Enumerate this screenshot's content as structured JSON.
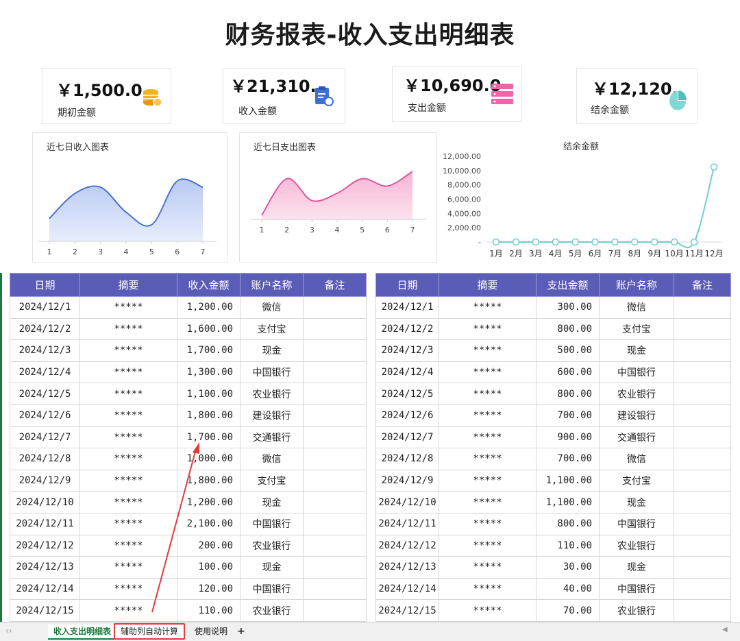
{
  "title": "财务报表-收入支出明细表",
  "cards": [
    {
      "amount": "￥1,500.0",
      "label": "期初金额",
      "icon": "coins-icon"
    },
    {
      "amount": "￥21,310.",
      "label": "收入金额",
      "icon": "clipboard-icon"
    },
    {
      "amount": "￥10,690.0",
      "label": "支出金额",
      "icon": "server-stack-icon"
    },
    {
      "amount": "￥12,120.",
      "label": "结余金额",
      "icon": "pie-icon"
    }
  ],
  "colors": {
    "header": "#5b5cb8",
    "income_line": "#4a72d0",
    "expense_line": "#e0559a",
    "balance_line": "#6dcfcb",
    "annotation": "#e23a3a"
  },
  "income_chart": {
    "title": "近七日收入图表",
    "chart_data": {
      "type": "area",
      "categories": [
        "1",
        "2",
        "3",
        "4",
        "5",
        "6",
        "7"
      ],
      "values": [
        1200,
        1600,
        1700,
        1300,
        1100,
        1800,
        1700
      ]
    }
  },
  "expense_chart": {
    "title": "近七日支出图表",
    "chart_data": {
      "type": "area",
      "categories": [
        "1",
        "2",
        "3",
        "4",
        "5",
        "6",
        "7"
      ],
      "values": [
        300,
        800,
        500,
        600,
        800,
        700,
        900
      ]
    }
  },
  "balance_chart": {
    "title": "结余金额",
    "chart_data": {
      "type": "line",
      "categories": [
        "1月",
        "2月",
        "3月",
        "4月",
        "5月",
        "6月",
        "7月",
        "8月",
        "9月",
        "10月",
        "11月",
        "12月"
      ],
      "values": [
        0,
        0,
        0,
        0,
        0,
        0,
        0,
        0,
        0,
        0,
        0,
        10500
      ],
      "yticks": [
        "12,000.00",
        "10,000.00",
        "8,000.00",
        "6,000.00",
        "4,000.00",
        "2,000.00",
        "-"
      ],
      "ylim": [
        0,
        12000
      ]
    }
  },
  "income_table": {
    "headers": [
      "日期",
      "摘要",
      "收入金额",
      "账户名称",
      "备注"
    ],
    "rows": [
      [
        "2024/12/1",
        "*****",
        "1,200.00",
        "微信",
        ""
      ],
      [
        "2024/12/2",
        "*****",
        "1,600.00",
        "支付宝",
        ""
      ],
      [
        "2024/12/3",
        "*****",
        "1,700.00",
        "现金",
        ""
      ],
      [
        "2024/12/4",
        "*****",
        "1,300.00",
        "中国银行",
        ""
      ],
      [
        "2024/12/5",
        "*****",
        "1,100.00",
        "农业银行",
        ""
      ],
      [
        "2024/12/6",
        "*****",
        "1,800.00",
        "建设银行",
        ""
      ],
      [
        "2024/12/7",
        "*****",
        "1,700.00",
        "交通银行",
        ""
      ],
      [
        "2024/12/8",
        "*****",
        "1,000.00",
        "微信",
        ""
      ],
      [
        "2024/12/9",
        "*****",
        "1,800.00",
        "支付宝",
        ""
      ],
      [
        "2024/12/10",
        "*****",
        "1,200.00",
        "现金",
        ""
      ],
      [
        "2024/12/11",
        "*****",
        "2,100.00",
        "中国银行",
        ""
      ],
      [
        "2024/12/12",
        "*****",
        "200.00",
        "农业银行",
        ""
      ],
      [
        "2024/12/13",
        "*****",
        "100.00",
        "现金",
        ""
      ],
      [
        "2024/12/14",
        "*****",
        "120.00",
        "中国银行",
        ""
      ],
      [
        "2024/12/15",
        "*****",
        "110.00",
        "农业银行",
        ""
      ]
    ]
  },
  "expense_table": {
    "headers": [
      "日期",
      "摘要",
      "支出金额",
      "账户名称",
      "备注"
    ],
    "rows": [
      [
        "2024/12/1",
        "*****",
        "300.00",
        "微信",
        ""
      ],
      [
        "2024/12/2",
        "*****",
        "800.00",
        "支付宝",
        ""
      ],
      [
        "2024/12/3",
        "*****",
        "500.00",
        "现金",
        ""
      ],
      [
        "2024/12/4",
        "*****",
        "600.00",
        "中国银行",
        ""
      ],
      [
        "2024/12/5",
        "*****",
        "800.00",
        "农业银行",
        ""
      ],
      [
        "2024/12/6",
        "*****",
        "700.00",
        "建设银行",
        ""
      ],
      [
        "2024/12/7",
        "*****",
        "900.00",
        "交通银行",
        ""
      ],
      [
        "2024/12/8",
        "*****",
        "700.00",
        "微信",
        ""
      ],
      [
        "2024/12/9",
        "*****",
        "1,100.00",
        "支付宝",
        ""
      ],
      [
        "2024/12/10",
        "*****",
        "1,100.00",
        "现金",
        ""
      ],
      [
        "2024/12/11",
        "*****",
        "800.00",
        "中国银行",
        ""
      ],
      [
        "2024/12/12",
        "*****",
        "110.00",
        "农业银行",
        ""
      ],
      [
        "2024/12/13",
        "*****",
        "30.00",
        "现金",
        ""
      ],
      [
        "2024/12/14",
        "*****",
        "40.00",
        "中国银行",
        ""
      ],
      [
        "2024/12/15",
        "*****",
        "70.00",
        "农业银行",
        ""
      ]
    ]
  },
  "sheet_tabs": [
    "收入支出明细表",
    "辅助列自动计算",
    "使用说明"
  ],
  "add_sheet": "+"
}
